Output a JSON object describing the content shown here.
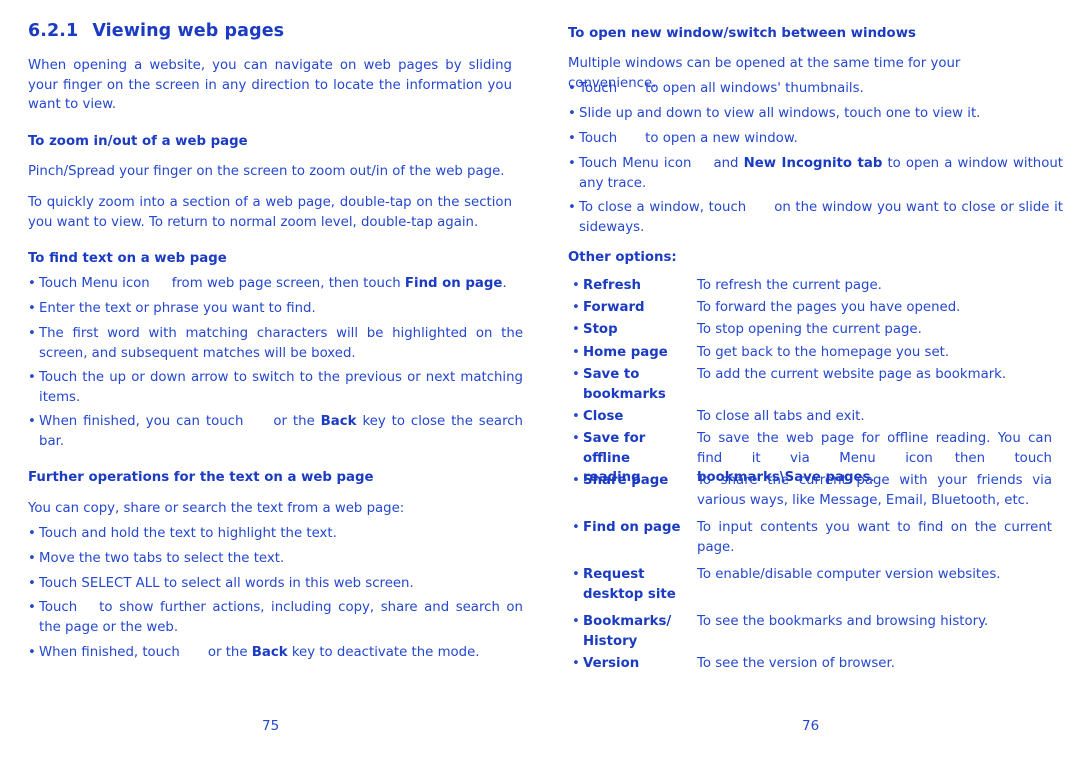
{
  "left": {
    "section_number": "6.2.1",
    "section_title": "Viewing web pages",
    "intro": "When opening a website, you can navigate on web pages by sliding your finger on the screen in any direction to locate the information you want to view.",
    "zoom_heading": "To zoom in/out of a web page",
    "zoom_p1": "Pinch/Spread your finger on the screen to zoom out/in of the web page.",
    "zoom_p2": "To quickly zoom into a section of a web page, double-tap on the section you want to view. To return to normal zoom level, double-tap again.",
    "find_heading": "To find text on a web page",
    "find_b1_a": "Touch Menu icon",
    "find_b1_b": "from web page screen, then touch",
    "find_b1_bold": "Find on page",
    "find_b2": "Enter the text or phrase you want to find.",
    "find_b3": "The first word with matching characters will be highlighted on the screen, and subsequent matches will be boxed.",
    "find_b4": "Touch the up or down arrow to switch to the previous or next matching items.",
    "find_b5_a": "When finished, you can touch",
    "find_b5_b": "or the",
    "find_b5_bold": "Back",
    "find_b5_c": "key to close the search bar.",
    "further_heading": "Further operations for the text on a web page",
    "further_p": "You can copy, share or search the text from a web page:",
    "further_b1": "Touch and hold the text to highlight the text.",
    "further_b2": "Move the two tabs to select the text.",
    "further_b3": "Touch SELECT ALL to select all words in this web screen.",
    "further_b4_a": "Touch",
    "further_b4_b": "to show further actions, including copy, share and search on the page or the web.",
    "further_b5_a": "When finished, touch",
    "further_b5_b": "or the",
    "further_b5_bold": "Back",
    "further_b5_c": "key to deactivate the mode.",
    "page_number": "75"
  },
  "right": {
    "windows_heading": "To open new window/switch between windows",
    "windows_p": "Multiple windows can be opened at the same time for your convenience.",
    "w_b1_a": "Touch",
    "w_b1_b": "to open all windows' thumbnails.",
    "w_b2": "Slide up and down to view all windows, touch one to view it.",
    "w_b3_a": "Touch",
    "w_b3_b": "to open a new window.",
    "w_b4_a": "Touch Menu icon",
    "w_b4_b": "and",
    "w_b4_bold": "New Incognito tab",
    "w_b4_c": "to open a window without any trace.",
    "w_b5_a": "To close a window, touch",
    "w_b5_b": "on the window you want to close or slide it sideways.",
    "other_heading": "Other options:",
    "options": [
      {
        "label": "Refresh",
        "desc": "To refresh the current page."
      },
      {
        "label": "Forward",
        "desc": "To forward the pages you have opened."
      },
      {
        "label": "Stop",
        "desc": "To stop opening the current page."
      },
      {
        "label": "Home page",
        "desc": "To get back to the homepage you set."
      },
      {
        "label": "Save to bookmarks",
        "desc": "To add the current website page as bookmark."
      },
      {
        "label": "Close",
        "desc": "To close all tabs and exit."
      },
      {
        "label": "Save for offline reading",
        "desc_a": "To save the web page for offline reading. You can find it via Menu icon",
        "desc_b": "then touch",
        "desc_bold": "bookmarks\\Save pages",
        "desc_c": "."
      },
      {
        "label": "Share page",
        "desc": "To share the current page with your friends via various ways, like Message, Email, Bluetooth, etc."
      },
      {
        "label": "Find on page",
        "desc": "To input contents you want to find on the current page."
      },
      {
        "label": "Request desktop site",
        "desc": "To enable/disable computer version websites."
      },
      {
        "label": "Bookmarks/ History",
        "desc": "To see the bookmarks and browsing history."
      },
      {
        "label": "Version",
        "desc": "To see the version of browser."
      }
    ],
    "page_number": "76"
  }
}
